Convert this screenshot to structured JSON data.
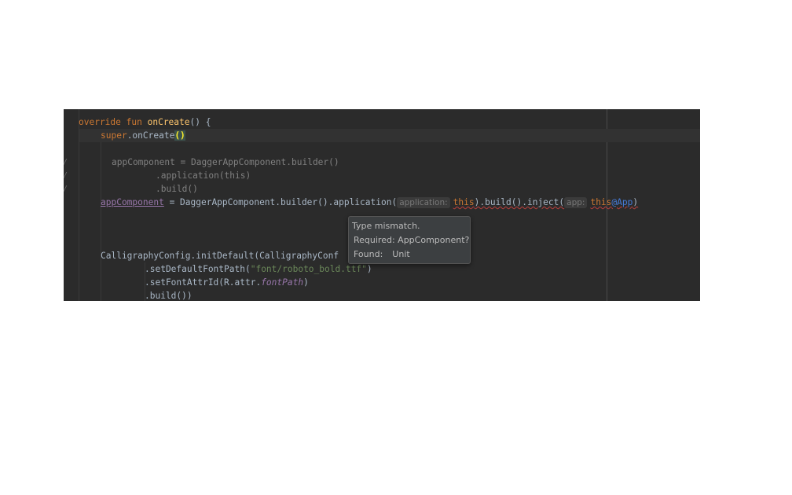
{
  "editor": {
    "lines": {
      "l1": {
        "kw1": "override",
        "kw2": "fun",
        "fn": "onCreate",
        "rest": "() {"
      },
      "l2": {
        "kw": "super",
        "call": ".onCreate",
        "paren": "()"
      },
      "l3": {
        "text": "appComponent = DaggerAppComponent.builder()"
      },
      "l4": {
        "text": ".application(this)"
      },
      "l5": {
        "text": ".build()"
      },
      "l6": {
        "prop": "appComponent",
        "mid": " = DaggerAppComponent.builder().application(",
        "hint1": "application:",
        "arg1": "this",
        "mid2": ").build().inject(",
        "hint2": "app:",
        "arg2": "this",
        "label": "@App",
        "end": ")"
      },
      "l7": {
        "text": "CalligraphyConfig.initDefault(CalligraphyConf"
      },
      "l8": {
        "call": ".setDefaultFontPath(",
        "str": "\"font/roboto_bold.ttf\"",
        "end": ")"
      },
      "l9": {
        "call": ".setFontAttrId(R.attr.",
        "field": "fontPath",
        "end": ")"
      },
      "l10": {
        "text": ".build())"
      }
    },
    "comment_marker": "/"
  },
  "tooltip": {
    "title": "Type mismatch.",
    "required_label": "Required:",
    "required_value": "AppComponent?",
    "found_label": "Found:",
    "found_value": "Unit"
  }
}
